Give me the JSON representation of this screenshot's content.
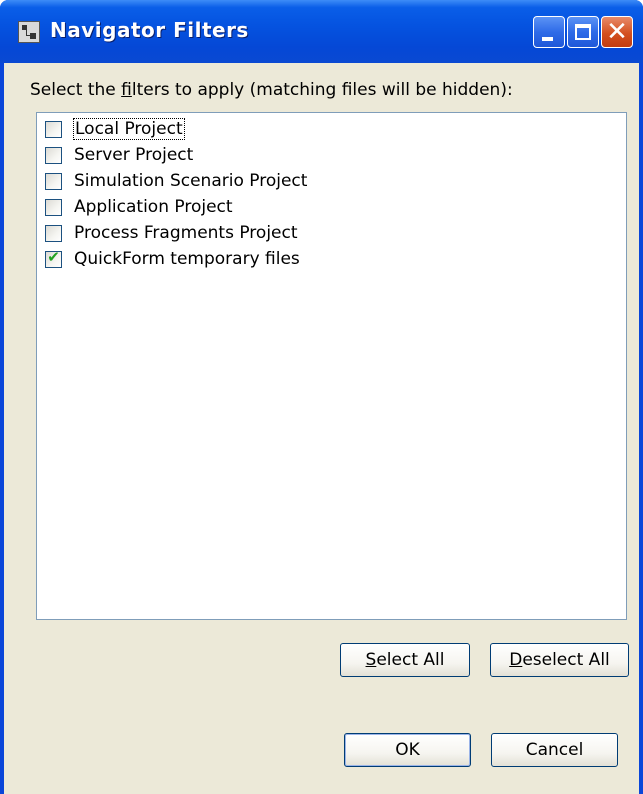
{
  "window": {
    "title": "Navigator Filters",
    "app_icon": "filter-dialog-icon",
    "caption_buttons": {
      "minimize": "minimize-icon",
      "maximize": "maximize-icon",
      "close": "close-icon",
      "close_glyph": "✕"
    }
  },
  "dialog": {
    "prompt_pre": "Select the ",
    "prompt_accel": "f",
    "prompt_post": "ilters to apply (matching files will be hidden):",
    "filters": [
      {
        "label": "Local Project",
        "checked": false,
        "focused": true
      },
      {
        "label": "Server Project",
        "checked": false
      },
      {
        "label": "Simulation Scenario Project",
        "checked": false
      },
      {
        "label": "Application Project",
        "checked": false
      },
      {
        "label": "Process Fragments Project",
        "checked": false
      },
      {
        "label": "QuickForm temporary files",
        "checked": true
      }
    ],
    "check_glyph": "✔",
    "select_all_accel": "S",
    "select_all_rest": "elect All",
    "deselect_all_accel": "D",
    "deselect_all_rest": "eselect All",
    "ok_label": "OK",
    "cancel_label": "Cancel"
  }
}
